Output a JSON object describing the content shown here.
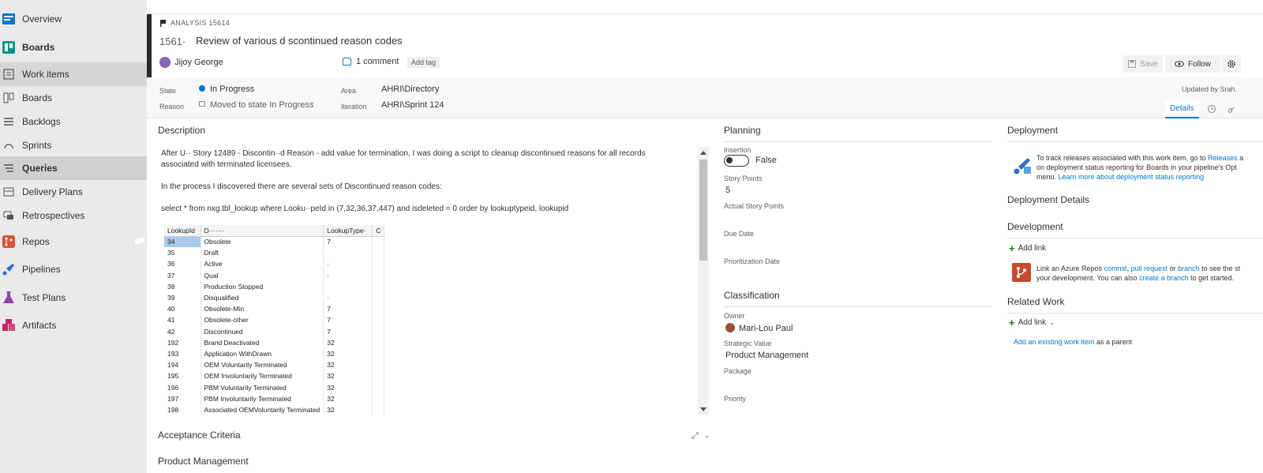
{
  "sidebar": {
    "items": [
      {
        "label": "Overview",
        "icon": "overview-icon",
        "color": "#0078d4"
      },
      {
        "label": "Boards",
        "icon": "boards-hub-icon",
        "color": "#009688"
      },
      {
        "label": "Work items",
        "icon": "work-items-icon"
      },
      {
        "label": "Boards",
        "icon": "boards-icon"
      },
      {
        "label": "Backlogs",
        "icon": "backlogs-icon"
      },
      {
        "label": "Sprints",
        "icon": "sprints-icon"
      },
      {
        "label": "Queries",
        "icon": "queries-icon"
      },
      {
        "label": "Delivery Plans",
        "icon": "delivery-plans-icon"
      },
      {
        "label": "Retrospectives",
        "icon": "retrospectives-icon"
      },
      {
        "label": "Repos",
        "icon": "repos-icon",
        "color": "#e04e2c"
      },
      {
        "label": "Pipelines",
        "icon": "pipelines-icon",
        "color": "#2b6cd4"
      },
      {
        "label": "Test Plans",
        "icon": "test-plans-icon",
        "color": "#8e44ad"
      },
      {
        "label": "Artifacts",
        "icon": "artifacts-icon",
        "color": "#cc2266"
      }
    ]
  },
  "work_item": {
    "type_label": "ANALYSIS 15614",
    "id": "1561·",
    "title": "Review of various d scontinued reason codes",
    "author": "Jijoy George",
    "comments": "1 comment",
    "add_tag": "Add tag",
    "save": "Save",
    "follow": "Follow"
  },
  "fields": {
    "state_label": "State",
    "state_value": "In Progress",
    "reason_label": "Reason",
    "reason_value": "Moved to state In Progress",
    "area_label": "Area",
    "area_value": "AHRI\\Directory",
    "iteration_label": "Iteration",
    "iteration_value": "AHRI\\Sprint 124",
    "updated_by": "Updated by Srah.",
    "tab_details": "Details"
  },
  "description": {
    "title": "Description",
    "line1": "After U·· Story 12489 - Discontin··d Reason - add value for termination, I was doing a script to cleanup discontinued reasons for all records",
    "line2": "associated with terminated licensees.",
    "line3": "In the process I discovered there are several sets of Discontinued reason codes:",
    "line4": "select * from nxg.tbl_lookup where Looku··peId in (7,32,36,37,447) and isdeleted = 0 order by lookuptypeid, lookupid",
    "table": {
      "headers": [
        "LookupId",
        "D·······",
        "LookupType·",
        "C"
      ],
      "rows": [
        [
          "34",
          "Obsolete",
          "7"
        ],
        [
          "35",
          "Draft",
          ""
        ],
        [
          "36",
          "Active",
          "·"
        ],
        [
          "37",
          "Qual",
          "·"
        ],
        [
          "38",
          "Production Stopped",
          ""
        ],
        [
          "39",
          "Disqualified",
          "·"
        ],
        [
          "40",
          "Obsolete-Min",
          "7"
        ],
        [
          "41",
          "Obsolete-other",
          "7"
        ],
        [
          "42",
          "Discontinued",
          "7"
        ],
        [
          "192",
          "Brand Deactivated",
          "32"
        ],
        [
          "193",
          "Application WithDrawn",
          "32"
        ],
        [
          "194",
          "OEM Voluntarily Terminated",
          "32"
        ],
        [
          "195",
          "OEM Involuntarily Terminated",
          "32"
        ],
        [
          "196",
          "PBM Voluntarily Terminated",
          "32"
        ],
        [
          "197",
          "PBM Involuntarily Terminated",
          "32"
        ],
        [
          "198",
          "Associated OEMVoluntarily Terminated",
          "32"
        ]
      ]
    }
  },
  "acceptance": {
    "title": "Acceptance Criteria"
  },
  "product_mgmt": {
    "title": "Product Management"
  },
  "planning": {
    "title": "Planning",
    "insertion_label": "Insertion",
    "insertion_value": "False",
    "story_points_label": "Story Points",
    "story_points_value": "5",
    "actual_sp_label": "Actual Story Points",
    "due_date_label": "Due Date",
    "prio_date_label": "Prioritization Date"
  },
  "classification": {
    "title": "Classification",
    "owner_label": "Owner",
    "owner_value": "Mari-Lou Paul",
    "strategic_label": "Strategic Value",
    "strategic_value": "Product Management",
    "package_label": "Package",
    "priority_label": "Priority"
  },
  "deployment": {
    "title": "Deployment",
    "text_a": "To track releases associated with this work item, go to ",
    "releases_link": "Releases",
    "text_b": " a",
    "text_c": "on deployment status reporting for Boards in your pipeline's Opt",
    "text_d": "menu. ",
    "learn_link": "Learn more about deployment status reporting",
    "details_title": "Deployment Details"
  },
  "development": {
    "title": "Development",
    "add_link": "Add link",
    "text_a": "Link an Azure Repos ",
    "commit_link": "commit",
    "pr_link": "pull request",
    "text_or": " or ",
    "branch_link": "branch",
    "text_b": " to see the st",
    "text_c": "your development. You can also ",
    "create_branch_link": "create a branch",
    "text_d": " to get started."
  },
  "related": {
    "title": "Related Work",
    "add_link": "Add link",
    "existing_link": "Add an existing work item",
    "as_parent": " as a parent"
  },
  "colors": {
    "accent": "#0078d4",
    "add_green": "#107c10"
  }
}
